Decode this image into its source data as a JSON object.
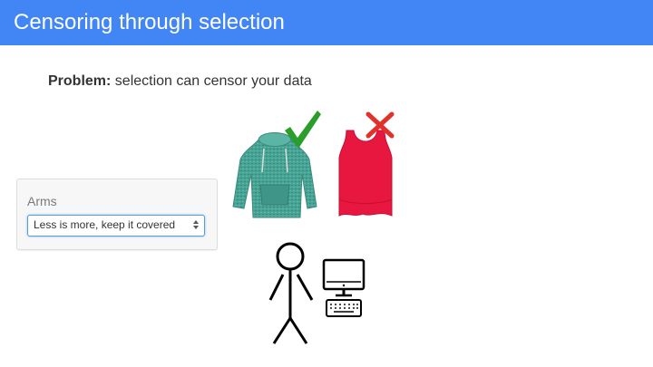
{
  "slide": {
    "title": "Censoring through selection",
    "problem_label": "Problem:",
    "problem_text": " selection can censor your data"
  },
  "form": {
    "field_label": "Arms",
    "selected_value": "Less is more, keep it covered"
  },
  "icons": {
    "sweater": "sweater-image-icon",
    "check": "checkmark-icon",
    "tank_top": "tank-top-image-icon",
    "cross": "cross-mark-icon",
    "person": "stick-figure-icon",
    "computer": "computer-icon"
  },
  "colors": {
    "title_bar": "#4285f4",
    "check": "#2a9d2a",
    "cross": "#e0312b",
    "sweater": "#47a394",
    "tank_top": "#e8173f"
  }
}
